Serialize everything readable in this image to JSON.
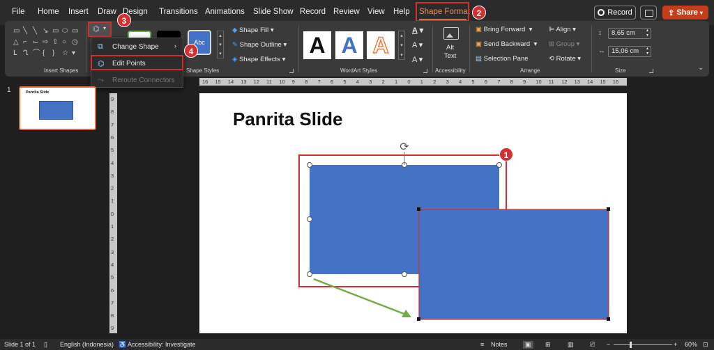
{
  "menu": {
    "file": "File",
    "home": "Home",
    "insert": "Insert",
    "draw": "Draw",
    "design": "Design",
    "transitions": "Transitions",
    "animations": "Animations",
    "slide_show": "Slide Show",
    "record": "Record",
    "review": "Review",
    "view": "View",
    "help": "Help",
    "shape_format": "Shape Format"
  },
  "top_buttons": {
    "record": "Record",
    "share": "Share"
  },
  "ribbon": {
    "insert_shapes": "Insert Shapes",
    "shape_styles": "Shape Styles",
    "shape_fill": "Shape Fill",
    "shape_outline": "Shape Outline",
    "shape_effects": "Shape Effects",
    "style_sample": "Abc",
    "wordart_styles": "WordArt Styles",
    "wordart_letter": "A",
    "accessibility": "Accessibility",
    "alt_text_1": "Alt",
    "alt_text_2": "Text",
    "bring_forward": "Bring Forward",
    "send_backward": "Send Backward",
    "selection_pane": "Selection Pane",
    "align": "Align",
    "group": "Group",
    "rotate": "Rotate",
    "arrange": "Arrange",
    "height": "8,65 cm",
    "width": "15,06 cm",
    "size": "Size"
  },
  "dropdown": {
    "change_shape": "Change Shape",
    "edit_points": "Edit Points",
    "reroute_connectors": "Reroute Connectors"
  },
  "callouts": {
    "c1": "1",
    "c2": "2",
    "c3": "3",
    "c4": "4"
  },
  "thumbnail": {
    "number": "1",
    "title": "Panrita Slide"
  },
  "slide": {
    "title": "Panrita Slide"
  },
  "rulers": {
    "horizontal": [
      "16",
      "15",
      "14",
      "13",
      "12",
      "11",
      "10",
      "9",
      "8",
      "7",
      "6",
      "5",
      "4",
      "3",
      "2",
      "1",
      "0",
      "1",
      "2",
      "3",
      "4",
      "5",
      "6",
      "7",
      "8",
      "9",
      "10",
      "11",
      "12",
      "13",
      "14",
      "15",
      "16"
    ],
    "vertical": [
      "9",
      "8",
      "7",
      "6",
      "5",
      "4",
      "3",
      "2",
      "1",
      "0",
      "1",
      "2",
      "3",
      "4",
      "5",
      "6",
      "7",
      "8",
      "9"
    ]
  },
  "status": {
    "slide_of": "Slide 1 of 1",
    "language": "English (Indonesia)",
    "accessibility": "Accessibility: Investigate",
    "notes": "Notes",
    "zoom": "60%"
  },
  "colors": {
    "accent": "#e0673a",
    "shape_fill": "#4472c4",
    "callout": "#d32f2f",
    "arrow": "#70ad47"
  }
}
